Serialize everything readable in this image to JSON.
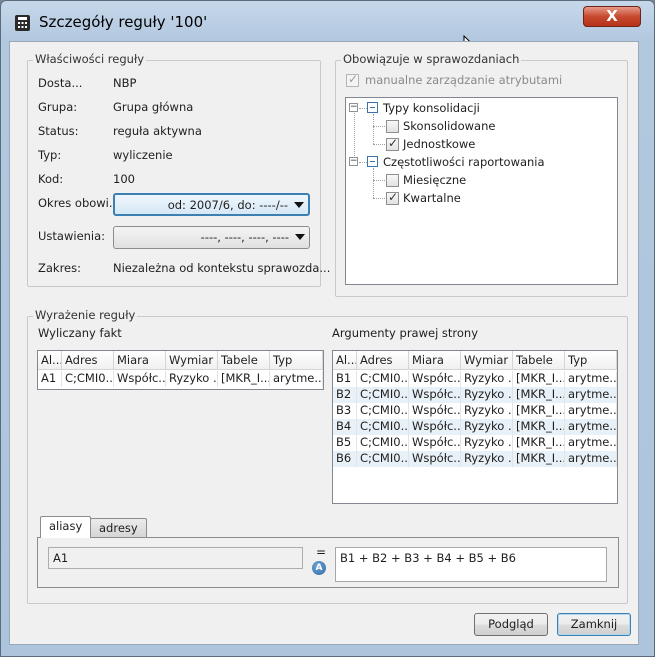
{
  "window": {
    "title": "Szczegóły reguły '100'",
    "close_glyph": "X"
  },
  "properties": {
    "group_title": "Właściwości reguły",
    "rows": [
      {
        "label": "Dosta...",
        "value": "NBP"
      },
      {
        "label": "Grupa:",
        "value": "Grupa główna"
      },
      {
        "label": "Status:",
        "value": "reguła aktywna"
      },
      {
        "label": "Typ:",
        "value": "wyliczenie"
      },
      {
        "label": "Kod:",
        "value": "100"
      }
    ],
    "period_label": "Okres obowi...",
    "period_value": "od: 2007/6, do: ----/--",
    "settings_label": "Ustawienia:",
    "settings_value": "----, ----, ----, ----",
    "scope_label": "Zakres:",
    "scope_value": "Niezależna od kontekstu sprawozda..."
  },
  "reports": {
    "group_title": "Obowiązuje w sprawozdaniach",
    "manual_label": "manualne zarządzanie atrybutami",
    "manual_checked": true,
    "tree": {
      "node1": "Typy konsolidacji",
      "node1_children": [
        {
          "label": "Skonsolidowane",
          "checked": false
        },
        {
          "label": "Jednostkowe",
          "checked": true
        }
      ],
      "node2": "Częstotliwości raportowania",
      "node2_children": [
        {
          "label": "Miesięczne",
          "checked": false
        },
        {
          "label": "Kwartalne",
          "checked": true
        }
      ]
    }
  },
  "expression": {
    "group_title": "Wyrażenie reguły",
    "left_title": "Wyliczany fakt",
    "right_title": "Argumenty prawej strony",
    "columns": [
      "Al...",
      "Adres",
      "Miara",
      "Wymiar",
      "Tabele",
      "Typ"
    ],
    "left_rows": [
      [
        "A1",
        "C;CMI0...",
        "Współc...",
        "Ryzyko ...",
        "[MKR_I...",
        "arytme..."
      ]
    ],
    "right_rows": [
      [
        "B1",
        "C;CMI0...",
        "Współc...",
        "Ryzyko ...",
        "[MKR_I...",
        "arytme..."
      ],
      [
        "B2",
        "C;CMI0...",
        "Współc...",
        "Ryzyko ...",
        "[MKR_I...",
        "arytme..."
      ],
      [
        "B3",
        "C;CMI0...",
        "Współc...",
        "Ryzyko ...",
        "[MKR_I...",
        "arytme..."
      ],
      [
        "B4",
        "C;CMI0...",
        "Współc...",
        "Ryzyko ...",
        "[MKR_I...",
        "arytme..."
      ],
      [
        "B5",
        "C;CMI0...",
        "Współc...",
        "Ryzyko ...",
        "[MKR_I...",
        "arytme..."
      ],
      [
        "B6",
        "C;CMI0...",
        "Współc...",
        "Ryzyko ...",
        "[MKR_I...",
        "arytme..."
      ]
    ],
    "tabs": [
      "aliasy",
      "adresy"
    ],
    "lhs_value": "A1",
    "equals": "=",
    "badge": "A",
    "rhs_value": "B1 + B2 + B3 + B4 + B5 + B6"
  },
  "footer": {
    "preview_label": "Podgląd",
    "close_label": "Zamknij"
  }
}
